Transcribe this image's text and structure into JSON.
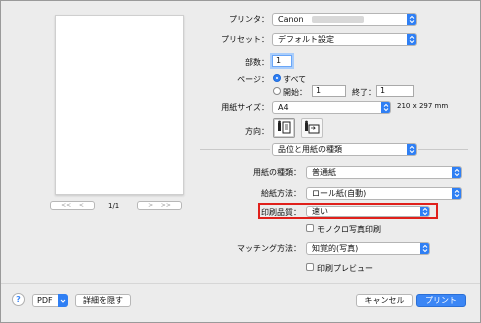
{
  "printer": {
    "label": "プリンタ：",
    "value": "Canon"
  },
  "preset": {
    "label": "プリセット：",
    "value": "デフォルト設定"
  },
  "copies": {
    "label": "部数：",
    "value": "1"
  },
  "pages": {
    "label": "ページ：",
    "all_label": "すべて",
    "from_label": "開始：",
    "from_value": "1",
    "to_label": "終了：",
    "to_value": "1"
  },
  "paper_size": {
    "label": "用紙サイズ：",
    "value": "A4",
    "dimensions": "210 x 297 mm"
  },
  "orientation": {
    "label": "方向："
  },
  "panel_menu": {
    "value": "品位と用紙の種類"
  },
  "media_type": {
    "label": "用紙の種類：",
    "value": "普通紙"
  },
  "paper_source": {
    "label": "給紙方法：",
    "value": "ロール紙(自動)"
  },
  "print_quality": {
    "label": "印刷品質：",
    "value": "速い",
    "highlight_color": "#e0201b"
  },
  "mono_photo": {
    "label": "モノクロ写真印刷"
  },
  "matching": {
    "label": "マッチング方法：",
    "value": "知覚的(写真)"
  },
  "print_preview": {
    "label": "印刷プレビュー"
  },
  "preview_nav": {
    "first": "<<",
    "prev": "<",
    "page_indicator": "1/1",
    "next": ">",
    "last": ">>"
  },
  "footer": {
    "help": "?",
    "pdf": "PDF",
    "hide_details": "詳細を隠す",
    "cancel": "キャンセル",
    "print": "プリント"
  },
  "colors": {
    "accent": "#2f7ff4",
    "window_bg": "#ececec"
  }
}
